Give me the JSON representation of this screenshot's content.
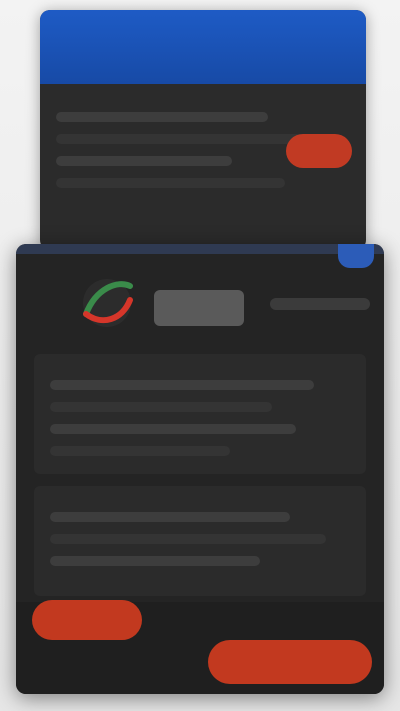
{
  "colors": {
    "titlebar_blue": "#1e5bc5",
    "dark_panel": "#242424",
    "accent_red": "#c2391f",
    "logo_green": "#3a8b4a",
    "logo_red": "#d5362a"
  },
  "icons": {
    "logo": "app-logo-icon"
  }
}
